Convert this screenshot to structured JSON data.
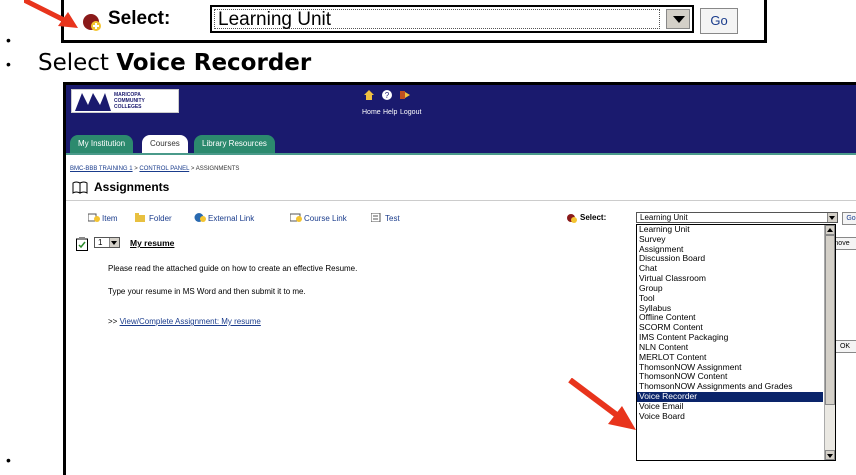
{
  "bullets": [
    "•",
    "•",
    "•"
  ],
  "zoom_bar": {
    "select_label": "Select:",
    "selected_value": "Learning Unit",
    "go_label": "Go",
    "icon": "add-icon"
  },
  "instruction": {
    "prefix": "Select ",
    "bold": "Voice Recorder"
  },
  "header": {
    "logo_text_1": "MARICOPA",
    "logo_text_2": "COMMUNITY",
    "logo_text_3": "COLLEGES",
    "links": [
      "Home",
      "Help",
      "Logout"
    ],
    "icons": [
      "home-icon",
      "help-icon",
      "logout-icon"
    ]
  },
  "tabs": [
    {
      "label": "My Institution",
      "active": false
    },
    {
      "label": "Courses",
      "active": true
    },
    {
      "label": "Library Resources",
      "active": false
    }
  ],
  "breadcrumb": {
    "course": "BMC-BBB TRAINING 1",
    "sep1": " > ",
    "panel": "CONTROL PANEL",
    "sep2": " > ",
    "current": "ASSIGNMENTS"
  },
  "page_title": "Assignments",
  "toolbar": {
    "item": "Item",
    "folder": "Folder",
    "external_link": "External Link",
    "course_link": "Course Link",
    "test": "Test",
    "select_label": "Select:",
    "selected_value": "Learning Unit",
    "go_label": "Go"
  },
  "dropdown_options": [
    "Learning Unit",
    "Survey",
    "Assignment",
    "Discussion Board",
    "Chat",
    "Virtual Classroom",
    "Group",
    "Tool",
    "Syllabus",
    "Offline Content",
    "SCORM Content",
    "IMS Content Packaging",
    "NLN Content",
    "MERLOT Content",
    "ThomsonNOW Assignment",
    "ThomsonNOW Content",
    "ThomsonNOW Assignments and Grades",
    "Voice Recorder",
    "Voice Email",
    "Voice Board"
  ],
  "dropdown_selected": "Voice Recorder",
  "hidden_buttons": {
    "remove_partial": "nove",
    "ok_partial": "OK"
  },
  "item": {
    "order": "1",
    "title": "My resume",
    "desc_1": "Please read the attached guide on how to create an effective Resume.",
    "desc_2": "Type your resume in MS Word and then submit it to me.",
    "link_prefix": ">> ",
    "link_text": "View/Complete Assignment: My resume"
  },
  "colors": {
    "header_bg": "#1a1a6e",
    "tab_bg": "#2c8a6e",
    "link": "#1a3c8c",
    "highlight": "#0a246a",
    "pointer_arrow": "#e8341c"
  }
}
